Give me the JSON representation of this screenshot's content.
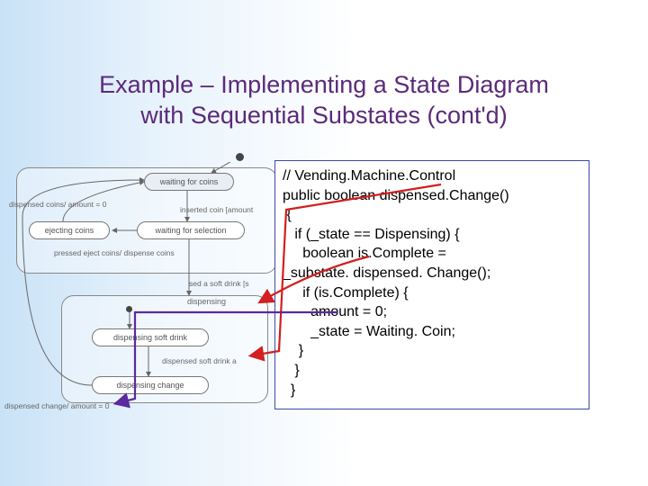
{
  "title": {
    "line1": "Example – Implementing a State Diagram",
    "line2": "with Sequential Substates (cont'd)"
  },
  "diagram": {
    "states": {
      "waiting_coins": "waiting for coins",
      "ejecting_coins": "ejecting coins",
      "waiting_selection": "waiting for selection",
      "dispensing": "dispensing",
      "disp_drink": "dispensing soft drink",
      "disp_change": "dispensing change"
    },
    "labels": {
      "l_dispensed_amount": "dispensed coins/ amount = 0",
      "l_inserted_coin": "inserted coin [amount",
      "l_pressed_eject": "pressed eject coins/ dispense coins",
      "l_sed_soft_drink": "sed a soft drink [s",
      "l_disp_soft_drink": "dispensed soft drink a",
      "l_disp_change_amount": "dispensed change/ amount = 0"
    }
  },
  "code": {
    "l0": "// Vending.Machine.Control",
    "l1": "public boolean dispensed.Change()",
    "l2": " {",
    "l3": "   if (_state == Dispensing) {",
    "l4": "     boolean is.Complete =",
    "l5": "_substate. dispensed. Change();",
    "l6": "     if (is.Complete) {",
    "l7": "       amount = 0;",
    "l8": "       _state = Waiting. Coin;",
    "l9": "    }",
    "l10": "   }",
    "l11": "  }"
  }
}
